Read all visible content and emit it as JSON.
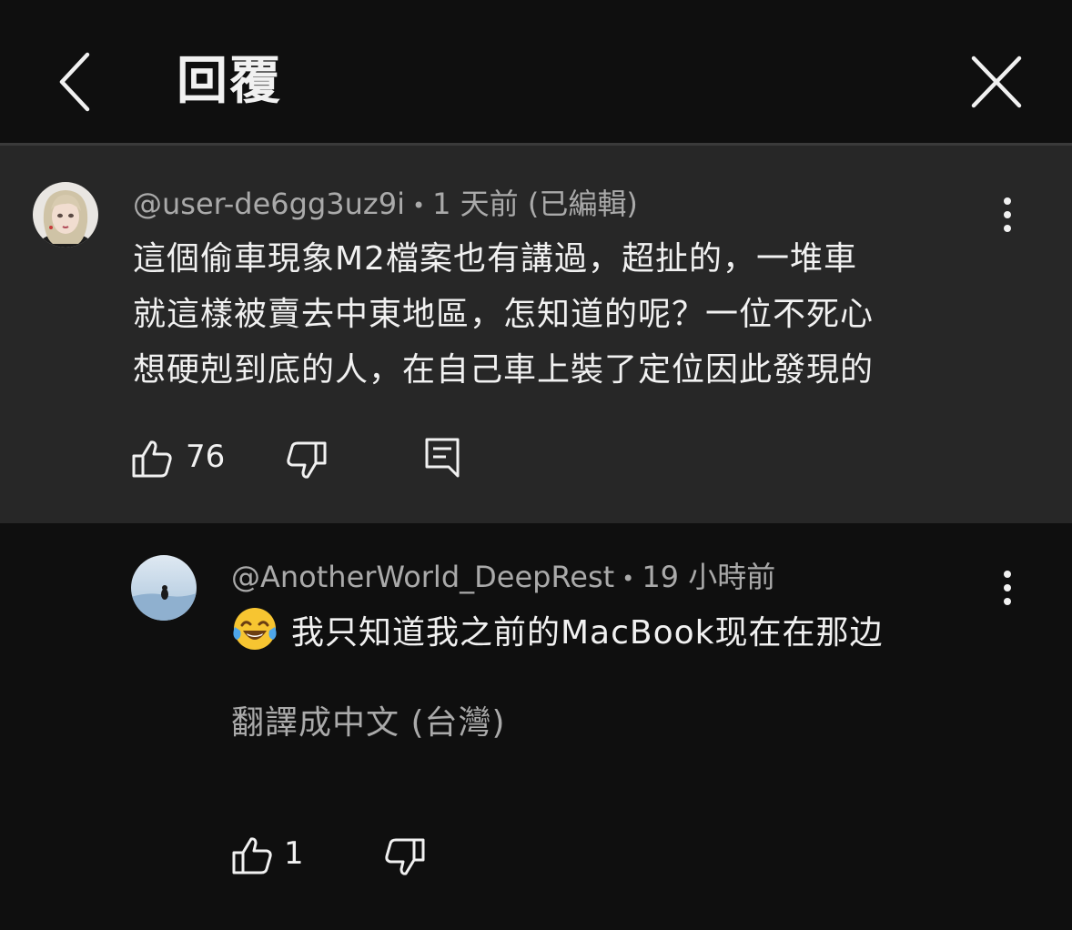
{
  "header": {
    "title": "回覆",
    "back_icon": "chevron-left-icon",
    "close_icon": "close-icon"
  },
  "comment": {
    "author": "@user-de6gg3uz9i",
    "separator": "•",
    "time": "1 天前 (已編輯)",
    "lines": [
      "這個偷車現象M2檔案也有講過，超扯的，一堆車",
      "就這樣被賣去中東地區，怎知道的呢？一位不死心",
      "想硬剋到底的人，在自己車上裝了定位因此發現的"
    ],
    "likes": "76",
    "icons": [
      "thumb-up-icon",
      "thumb-down-icon",
      "reply-icon",
      "more-icon"
    ]
  },
  "reply": {
    "author": "@AnotherWorld_DeepRest",
    "separator": "•",
    "time": "19 小時前",
    "emoji": "😂",
    "text": "我只知道我之前的MacBook现在在那边",
    "translate": "翻譯成中文 (台灣)",
    "likes": "1",
    "icons": [
      "thumb-up-icon",
      "thumb-down-icon",
      "more-icon"
    ]
  },
  "colors": {
    "background": "#0f0f0f",
    "highlight": "#272727",
    "text": "#f1f1f1",
    "secondary_text": "#aaaaaa",
    "divider": "#3a3a3a"
  }
}
